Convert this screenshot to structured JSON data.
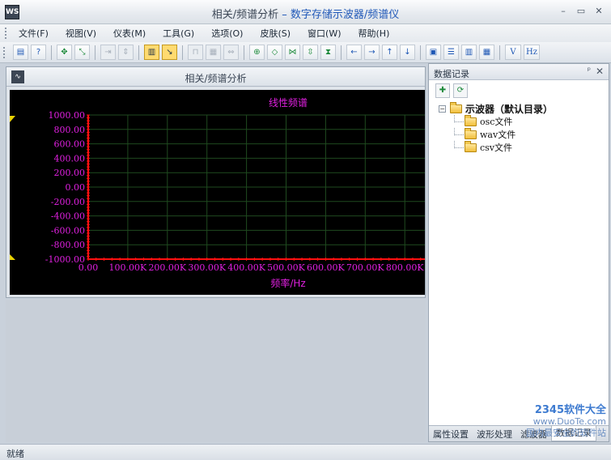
{
  "window": {
    "title_main": "相关/频谱分析",
    "title_sep": " – ",
    "title_app": "数字存储示波器/频谱仪",
    "app_icon": "WS",
    "minimize": "–",
    "maximize": "▭",
    "close": "✕"
  },
  "menu": {
    "items": [
      "文件(F)",
      "视图(V)",
      "仪表(M)",
      "工具(G)",
      "选项(O)",
      "皮肤(S)",
      "窗口(W)",
      "帮助(H)"
    ]
  },
  "toolbar": {
    "icons": [
      "save-icon",
      "help-icon",
      "move-icon",
      "resize-icon",
      "shrink-icon",
      "expand-icon",
      "dual-view-icon",
      "cursor-icon",
      "pulse-icon",
      "layer-icon",
      "fit-icon",
      "zoom-in-icon",
      "zoom-horizontal-icon",
      "zoom-fit-icon",
      "zoom-vertical-icon",
      "zoom-full-icon",
      "arrow-left-icon",
      "arrow-right-icon",
      "arrow-up-icon",
      "arrow-down-icon",
      "layout-1-icon",
      "layout-2-icon",
      "layout-3-icon",
      "layout-4-icon"
    ],
    "v_label": "V",
    "hz_label": "Hz"
  },
  "chart_panel": {
    "title": "相关/频谱分析"
  },
  "chart_data": {
    "type": "line",
    "title": "线性频谱",
    "xlabel": "频率/Hz",
    "ylabel": "",
    "y_ticks": [
      "1000.00",
      "800.00",
      "600.00",
      "400.00",
      "200.00",
      "0.00",
      "-200.00",
      "-400.00",
      "-600.00",
      "-800.00",
      "-1000.00"
    ],
    "x_ticks": [
      "0.00",
      "100.00K",
      "200.00K",
      "300.00K",
      "400.00K",
      "500.00K",
      "600.00K",
      "700.00K",
      "800.00K"
    ],
    "ylim": [
      -1000,
      1000
    ],
    "xlim": [
      0,
      800000
    ],
    "grid": true,
    "series": [],
    "colors": {
      "background": "#000000",
      "axis": "#ff1010",
      "text": "#e020e0",
      "grid": "#1f4a1f"
    }
  },
  "right_panel": {
    "title": "数据记录",
    "pin": "ᵖ",
    "close": "✕",
    "tools": [
      "new-file-icon",
      "refresh-icon"
    ],
    "tree": {
      "root": "示波器（默认目录）",
      "expander": "−",
      "children": [
        "osc文件",
        "wav文件",
        "csv文件"
      ]
    },
    "tabs": [
      "属性设置",
      "波形处理",
      "滤波器",
      "数据记录"
    ],
    "selected_tab": "数据记录"
  },
  "status": {
    "text": "就绪"
  },
  "watermark": {
    "brand": "2345软件大全",
    "url": "www.DuoTe.com",
    "tagline": "国内最安全的软件站"
  }
}
